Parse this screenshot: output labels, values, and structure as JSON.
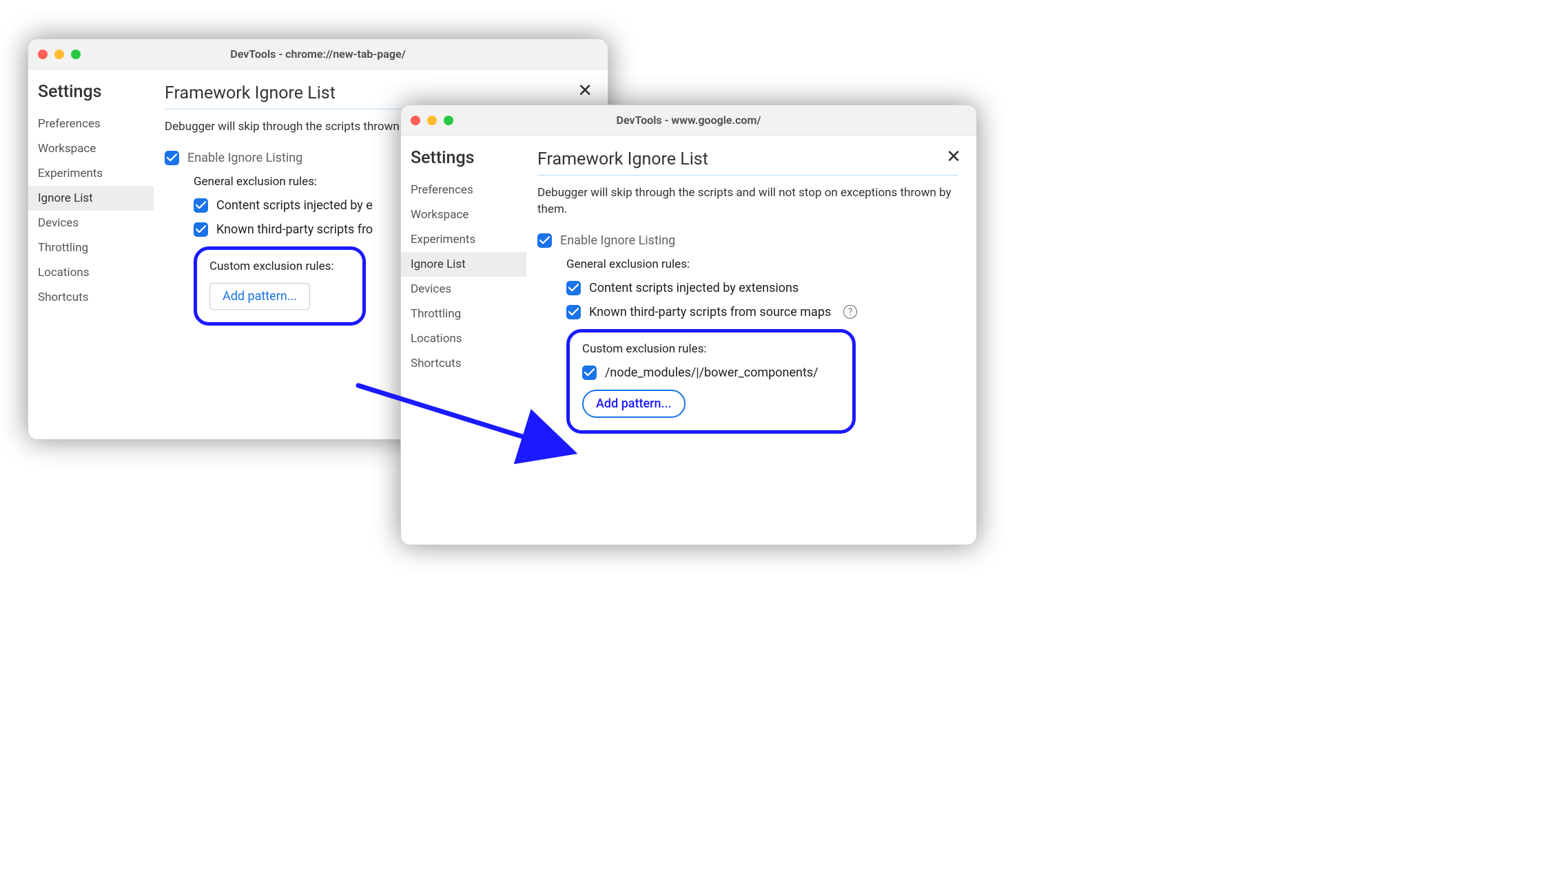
{
  "window1": {
    "title": "DevTools - chrome://new-tab-page/",
    "settings_heading": "Settings",
    "sidebar": [
      "Preferences",
      "Workspace",
      "Experiments",
      "Ignore List",
      "Devices",
      "Throttling",
      "Locations",
      "Shortcuts"
    ],
    "active_index": 3,
    "panel": {
      "title": "Framework Ignore List",
      "description_partial": "Debugger will skip through the scripts thrown by them.",
      "enable_label": "Enable Ignore Listing",
      "general_heading": "General exclusion rules:",
      "rule1_partial": "Content scripts injected by e",
      "rule2_partial": "Known third-party scripts fro",
      "custom_heading": "Custom exclusion rules:",
      "add_button": "Add pattern..."
    }
  },
  "window2": {
    "title": "DevTools - www.google.com/",
    "settings_heading": "Settings",
    "sidebar": [
      "Preferences",
      "Workspace",
      "Experiments",
      "Ignore List",
      "Devices",
      "Throttling",
      "Locations",
      "Shortcuts"
    ],
    "active_index": 3,
    "panel": {
      "title": "Framework Ignore List",
      "description": "Debugger will skip through the scripts and will not stop on exceptions thrown by them.",
      "enable_label": "Enable Ignore Listing",
      "general_heading": "General exclusion rules:",
      "rule1": "Content scripts injected by extensions",
      "rule2": "Known third-party scripts from source maps",
      "custom_heading": "Custom exclusion rules:",
      "custom_pattern": "/node_modules/|/bower_components/",
      "add_button": "Add pattern..."
    }
  }
}
